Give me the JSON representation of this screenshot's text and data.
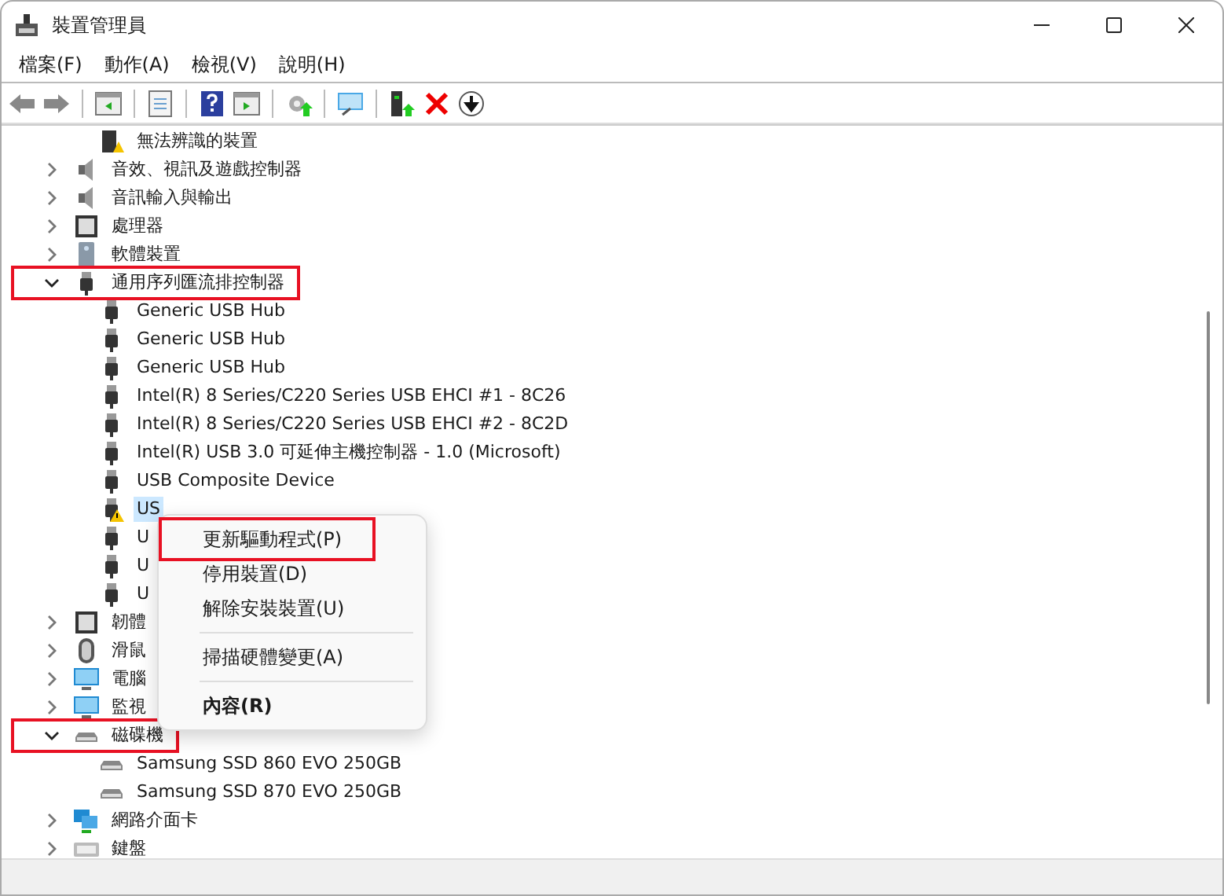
{
  "window": {
    "title": "裝置管理員"
  },
  "menu": [
    "檔案(F)",
    "動作(A)",
    "檢視(V)",
    "說明(H)"
  ],
  "tree": [
    {
      "label": "無法辨識的裝置",
      "kind": "unknown"
    },
    {
      "label": "音效、視訊及遊戲控制器",
      "kind": "speaker",
      "expanded": false,
      "highlighted": false
    },
    {
      "label": "音訊輸入與輸出",
      "kind": "speaker",
      "expanded": false,
      "highlighted": false
    },
    {
      "label": "處理器",
      "kind": "chip",
      "expanded": false,
      "highlighted": false
    },
    {
      "label": "軟體裝置",
      "kind": "tower",
      "expanded": false,
      "highlighted": false
    },
    {
      "label": "通用序列匯流排控制器",
      "kind": "usb",
      "expanded": true,
      "highlighted": true,
      "children": [
        {
          "label": "Generic USB Hub",
          "kind": "usb",
          "selected": false,
          "warning": false
        },
        {
          "label": "Generic USB Hub",
          "kind": "usb",
          "selected": false,
          "warning": false
        },
        {
          "label": "Generic USB Hub",
          "kind": "usb",
          "selected": false,
          "warning": false
        },
        {
          "label": "Intel(R) 8 Series/C220 Series USB EHCI #1 - 8C26",
          "kind": "usb",
          "selected": false,
          "warning": false
        },
        {
          "label": "Intel(R) 8 Series/C220 Series USB EHCI #2 - 8C2D",
          "kind": "usb",
          "selected": false,
          "warning": false
        },
        {
          "label": "Intel(R) USB 3.0 可延伸主機控制器 - 1.0 (Microsoft)",
          "kind": "usb",
          "selected": false,
          "warning": false
        },
        {
          "label": "USB Composite Device",
          "kind": "usb",
          "selected": false,
          "warning": false
        },
        {
          "label": "US",
          "kind": "usb",
          "selected": true,
          "warning": true
        },
        {
          "label": "U",
          "kind": "usb",
          "selected": false,
          "warning": false
        },
        {
          "label": "U",
          "kind": "usb",
          "selected": false,
          "warning": false
        },
        {
          "label": "U",
          "kind": "usb",
          "selected": false,
          "warning": false
        }
      ]
    },
    {
      "label": "韌體",
      "kind": "chip",
      "expanded": false,
      "highlighted": false
    },
    {
      "label": "滑鼠",
      "kind": "mouse",
      "expanded": false,
      "highlighted": false
    },
    {
      "label": "電腦",
      "kind": "monitor",
      "expanded": false,
      "highlighted": false
    },
    {
      "label": "監視",
      "kind": "monitor",
      "expanded": false,
      "highlighted": false
    },
    {
      "label": "磁碟機",
      "kind": "disk",
      "expanded": true,
      "highlighted": true,
      "children": [
        {
          "label": "Samsung SSD 860 EVO 250GB",
          "kind": "disk",
          "selected": false,
          "warning": false
        },
        {
          "label": "Samsung SSD 870 EVO 250GB",
          "kind": "disk",
          "selected": false,
          "warning": false
        }
      ]
    },
    {
      "label": "網路介面卡",
      "kind": "network",
      "expanded": false,
      "highlighted": false
    },
    {
      "label": "鍵盤",
      "kind": "keyboard",
      "expanded": false,
      "highlighted": false
    }
  ],
  "context_menu": [
    {
      "label": "更新驅動程式(P)",
      "kind": "item",
      "highlighted": true,
      "bold": false
    },
    {
      "label": "停用裝置(D)",
      "kind": "item",
      "highlighted": false,
      "bold": false
    },
    {
      "label": "解除安裝裝置(U)",
      "kind": "item",
      "highlighted": false,
      "bold": false
    },
    {
      "kind": "separator"
    },
    {
      "label": "掃描硬體變更(A)",
      "kind": "item",
      "highlighted": false,
      "bold": false
    },
    {
      "kind": "separator"
    },
    {
      "label": "內容(R)",
      "kind": "item",
      "highlighted": false,
      "bold": true
    }
  ]
}
